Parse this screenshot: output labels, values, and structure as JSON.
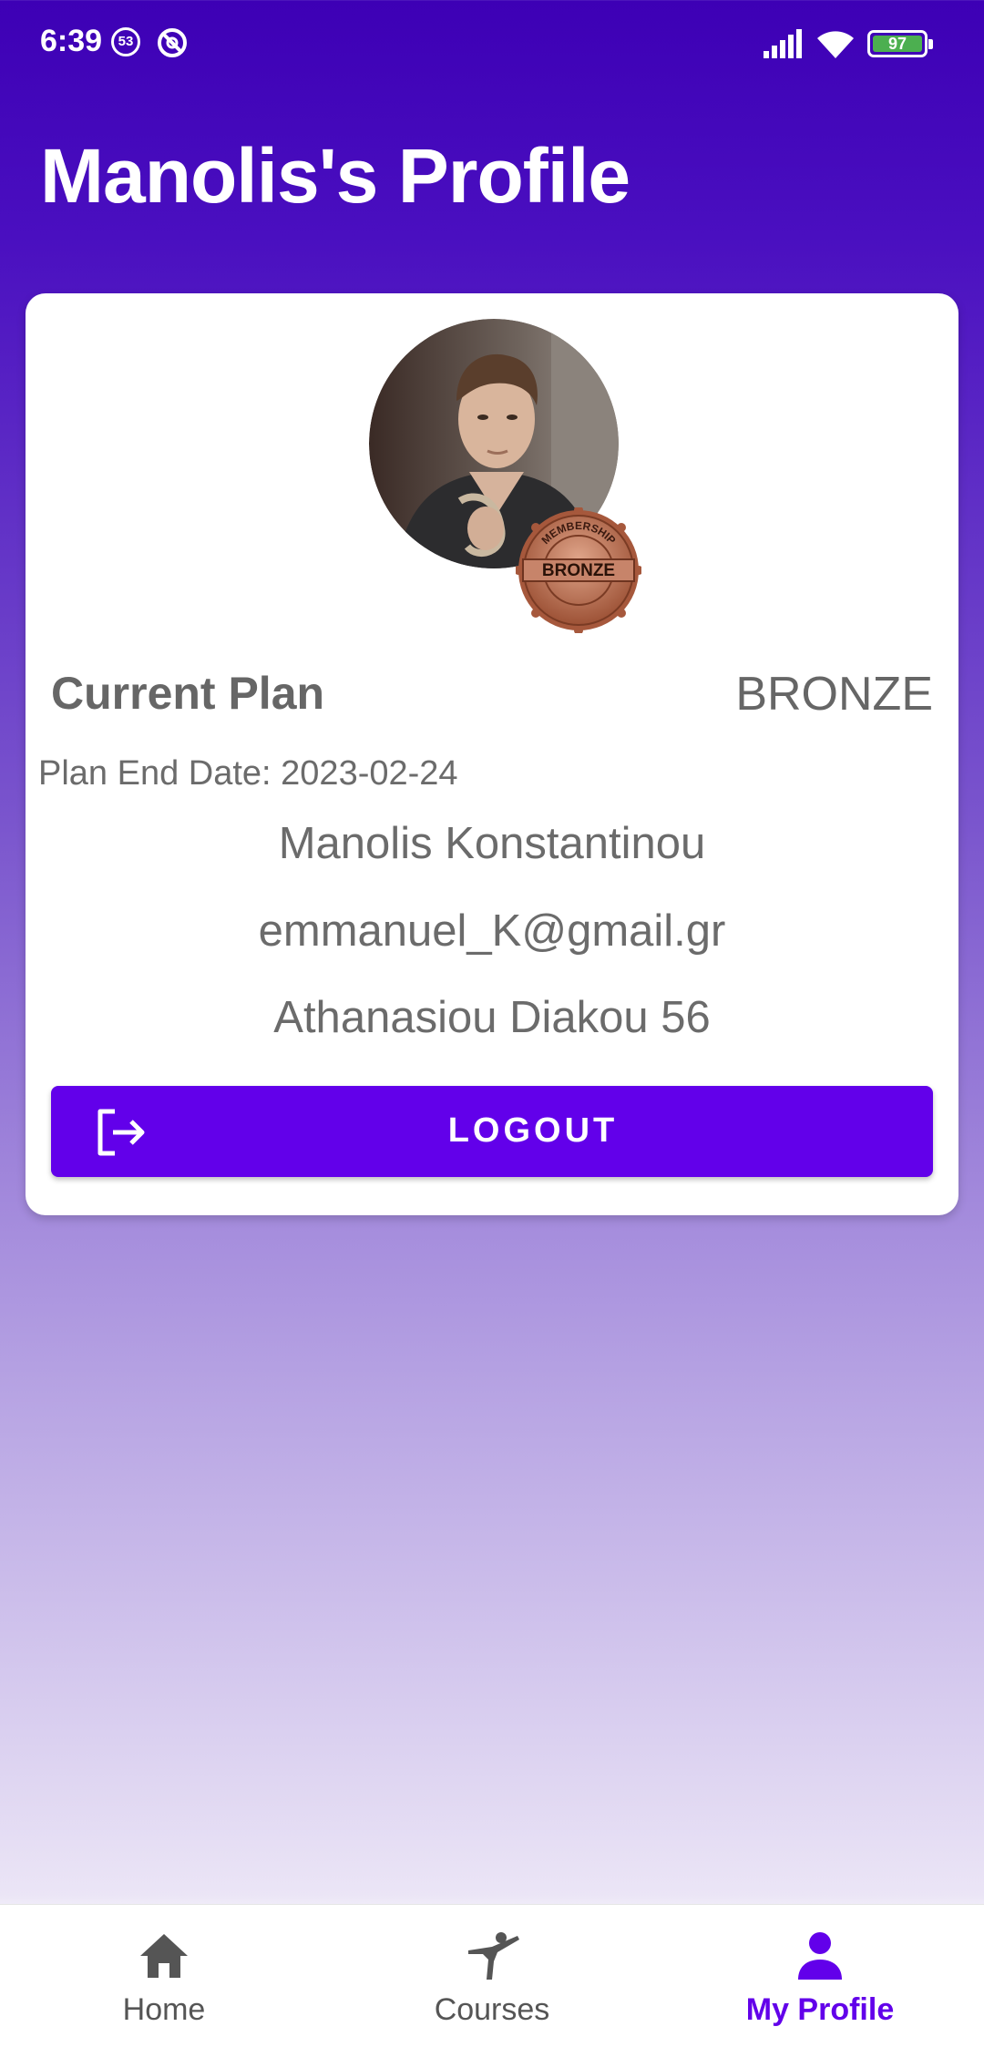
{
  "status_bar": {
    "time": "6:39",
    "notification_count": "53",
    "battery": "97"
  },
  "header": {
    "title": "Manolis's Profile"
  },
  "profile": {
    "badge_text": "BRONZE",
    "badge_ring_text": "MEMBERSHIP",
    "plan_label": "Current Plan",
    "plan_value": "BRONZE",
    "plan_end": "Plan End Date: 2023-02-24",
    "name": "Manolis Konstantinou",
    "email": "emmanuel_K@gmail.gr",
    "address": "Athanasiou Diakou 56",
    "logout_label": "LOGOUT"
  },
  "bottom_nav": {
    "items": [
      {
        "label": "Home",
        "icon": "home-icon"
      },
      {
        "label": "Courses",
        "icon": "martial-arts-icon"
      },
      {
        "label": "My Profile",
        "icon": "person-icon",
        "active": true
      }
    ]
  },
  "colors": {
    "accent": "#6200ea",
    "header_bg": "#3d00b5",
    "bronze": "#b8664a"
  }
}
